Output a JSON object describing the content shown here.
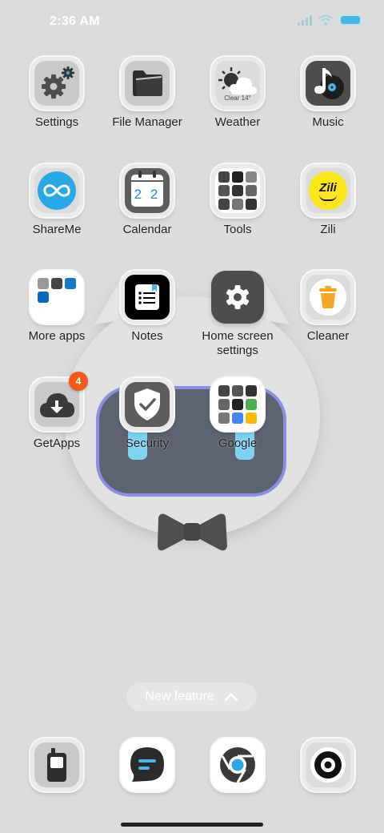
{
  "status_bar": {
    "time": "2:36 AM",
    "icons": [
      "signal-icon",
      "wifi-icon",
      "battery-icon"
    ]
  },
  "apps": {
    "settings": {
      "label": "Settings",
      "icon": "gear-icon"
    },
    "file_manager": {
      "label": "File Manager",
      "icon": "folder-icon"
    },
    "weather": {
      "label": "Weather",
      "icon": "weather-icon",
      "condition": "Clear 14°"
    },
    "music": {
      "label": "Music",
      "icon": "music-icon"
    },
    "shareme": {
      "label": "ShareMe",
      "icon": "infinity-icon"
    },
    "calendar": {
      "label": "Calendar",
      "icon": "calendar-icon",
      "date": "2 2"
    },
    "tools": {
      "label": "Tools",
      "icon": "folder-grid-icon"
    },
    "zili": {
      "label": "Zili",
      "icon": "zili-icon",
      "logo_text": "Zili"
    },
    "more_apps": {
      "label": "More apps",
      "icon": "folder-grid-icon"
    },
    "notes": {
      "label": "Notes",
      "icon": "notes-icon"
    },
    "home_screen_settings": {
      "label": "Home screen settings",
      "icon": "gear-icon"
    },
    "cleaner": {
      "label": "Cleaner",
      "icon": "trash-icon"
    },
    "getapps": {
      "label": "GetApps",
      "icon": "cloud-download-icon",
      "badge": "4"
    },
    "security": {
      "label": "Security",
      "icon": "shield-check-icon"
    },
    "google": {
      "label": "Google",
      "icon": "folder-grid-icon"
    }
  },
  "new_feature": {
    "label": "New feature"
  },
  "dock": [
    {
      "name": "phone",
      "icon": "phone-icon"
    },
    {
      "name": "messages",
      "icon": "chat-icon"
    },
    {
      "name": "browser",
      "icon": "browser-icon"
    },
    {
      "name": "camera",
      "icon": "camera-icon"
    }
  ],
  "colors": {
    "background": "#dcdcdc",
    "accent": "#4ab7e2",
    "badge": "#f05a1c"
  }
}
